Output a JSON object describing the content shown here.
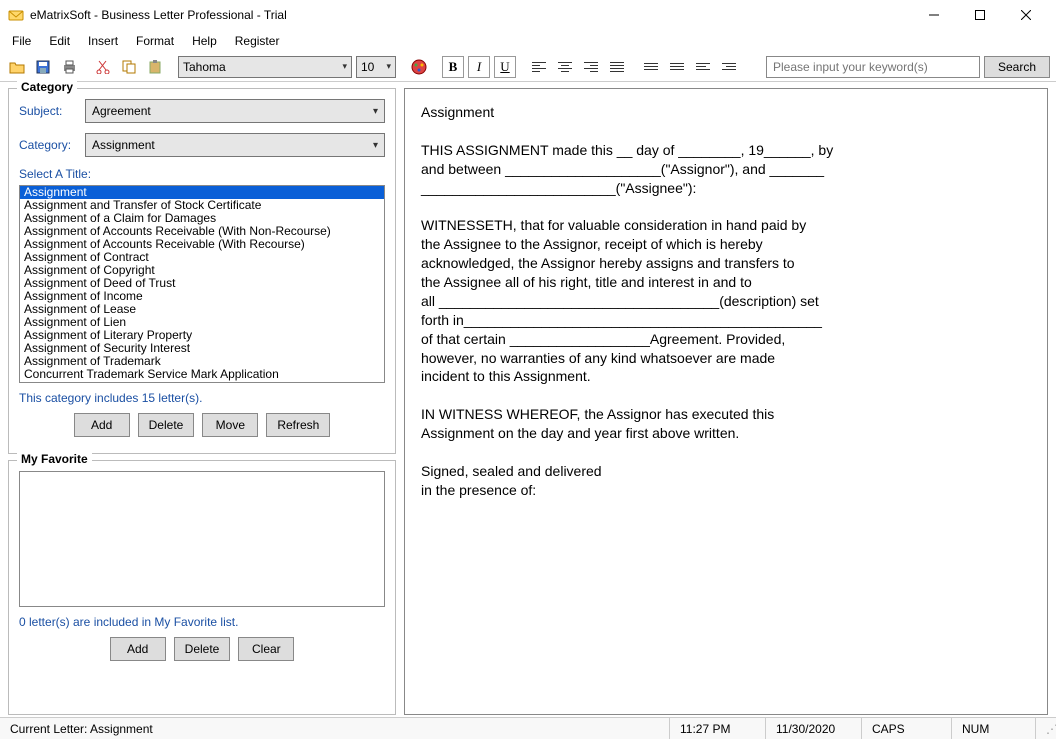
{
  "window": {
    "title": "eMatrixSoft - Business Letter Professional - Trial"
  },
  "menu": [
    "File",
    "Edit",
    "Insert",
    "Format",
    "Help",
    "Register"
  ],
  "toolbar": {
    "font": "Tahoma",
    "size": "10",
    "search_placeholder": "Please input your keyword(s)",
    "search_button": "Search"
  },
  "category": {
    "legend": "Category",
    "subject_label": "Subject:",
    "subject_value": "Agreement",
    "category_label": "Category:",
    "category_value": "Assignment",
    "select_title_label": "Select A Title:",
    "titles": [
      "Assignment",
      "Assignment and Transfer of Stock Certificate",
      "Assignment of a Claim for Damages",
      "Assignment of Accounts Receivable (With Non-Recourse)",
      "Assignment of Accounts Receivable (With Recourse)",
      "Assignment of Contract",
      "Assignment of Copyright",
      "Assignment of Deed of Trust",
      "Assignment of Income",
      "Assignment of Lease",
      "Assignment of Lien",
      "Assignment of Literary Property",
      "Assignment of Security Interest",
      "Assignment of Trademark",
      "Concurrent Trademark Service Mark Application"
    ],
    "count_label": "This category includes 15 letter(s).",
    "buttons": {
      "add": "Add",
      "delete": "Delete",
      "move": "Move",
      "refresh": "Refresh"
    }
  },
  "favorite": {
    "legend": "My Favorite",
    "count_label": "0 letter(s) are included in My Favorite list.",
    "buttons": {
      "add": "Add",
      "delete": "Delete",
      "clear": "Clear"
    }
  },
  "preview": {
    "text": "Assignment\n\nTHIS ASSIGNMENT made this __ day of ________, 19______, by\nand between ____________________(\"Assignor\"), and _______\n_________________________(\"Assignee\"):\n\nWITNESSETH, that for valuable consideration in hand paid by\nthe Assignee to the Assignor, receipt of which is hereby\nacknowledged, the Assignor hereby assigns and transfers to\nthe Assignee all of his right, title and interest in and to\nall ____________________________________(description) set\nforth in______________________________________________\nof that certain __________________Agreement. Provided,\nhowever, no warranties of any kind whatsoever are made\nincident to this Assignment.\n\nIN WITNESS WHEREOF, the Assignor has executed this\nAssignment on the day and year first above written.\n\nSigned, sealed and delivered\nin the presence of:"
  },
  "status": {
    "current": "Current Letter: Assignment",
    "time": "11:27 PM",
    "date": "11/30/2020",
    "caps": "CAPS",
    "num": "NUM"
  }
}
